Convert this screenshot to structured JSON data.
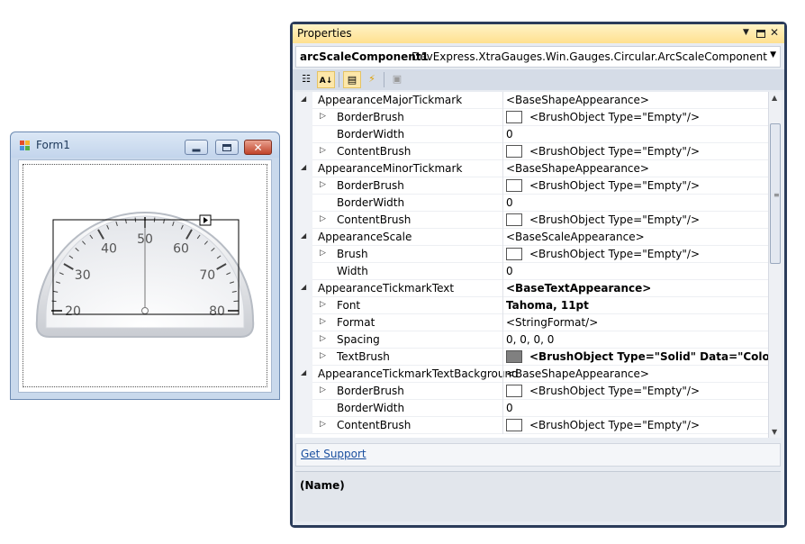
{
  "form": {
    "title": "Form1",
    "icon": "form-icon",
    "caption_buttons": [
      "minimize-icon",
      "maximize-icon",
      "close-icon"
    ]
  },
  "gauge": {
    "scale_min": 20,
    "scale_max": 80,
    "major_step": 10,
    "minor_step": 2,
    "needle_value": 50,
    "tick_labels": [
      "20",
      "30",
      "40",
      "50",
      "60",
      "70",
      "80"
    ],
    "smart_tag_icon": "smart-tag-arrow-icon"
  },
  "properties": {
    "window_title": "Properties",
    "titlebar_icons": [
      "dropdown-arrow-icon",
      "maximize-icon",
      "close-icon"
    ],
    "object_name": "arcScaleComponent1",
    "object_type": "DevExpress.XtraGauges.Win.Gauges.Circular.ArcScaleComponent",
    "toolbar": [
      "categorized-icon",
      "alphabetical-icon",
      "properties-icon",
      "events-icon",
      "property-pages-icon"
    ],
    "rows": [
      {
        "level": 0,
        "expander": "expanded",
        "name": "AppearanceMajorTickmark",
        "value": "<BaseShapeAppearance>",
        "swatch": "",
        "bold": false
      },
      {
        "level": 1,
        "expander": "collapsed",
        "name": "BorderBrush",
        "value": "<BrushObject Type=\"Empty\"/>",
        "swatch": "white",
        "bold": false
      },
      {
        "level": 1,
        "expander": "",
        "name": "BorderWidth",
        "value": "0",
        "swatch": "",
        "bold": false
      },
      {
        "level": 1,
        "expander": "collapsed",
        "name": "ContentBrush",
        "value": "<BrushObject Type=\"Empty\"/>",
        "swatch": "white",
        "bold": false
      },
      {
        "level": 0,
        "expander": "expanded",
        "name": "AppearanceMinorTickmark",
        "value": "<BaseShapeAppearance>",
        "swatch": "",
        "bold": false
      },
      {
        "level": 1,
        "expander": "collapsed",
        "name": "BorderBrush",
        "value": "<BrushObject Type=\"Empty\"/>",
        "swatch": "white",
        "bold": false
      },
      {
        "level": 1,
        "expander": "",
        "name": "BorderWidth",
        "value": "0",
        "swatch": "",
        "bold": false
      },
      {
        "level": 1,
        "expander": "collapsed",
        "name": "ContentBrush",
        "value": "<BrushObject Type=\"Empty\"/>",
        "swatch": "white",
        "bold": false
      },
      {
        "level": 0,
        "expander": "expanded",
        "name": "AppearanceScale",
        "value": "<BaseScaleAppearance>",
        "swatch": "",
        "bold": false
      },
      {
        "level": 1,
        "expander": "collapsed",
        "name": "Brush",
        "value": "<BrushObject Type=\"Empty\"/>",
        "swatch": "white",
        "bold": false
      },
      {
        "level": 1,
        "expander": "",
        "name": "Width",
        "value": "0",
        "swatch": "",
        "bold": false
      },
      {
        "level": 0,
        "expander": "expanded",
        "name": "AppearanceTickmarkText",
        "value": "<BaseTextAppearance>",
        "swatch": "",
        "bold": true
      },
      {
        "level": 1,
        "expander": "collapsed",
        "name": "Font",
        "value": "Tahoma, 11pt",
        "swatch": "",
        "bold": true
      },
      {
        "level": 1,
        "expander": "collapsed",
        "name": "Format",
        "value": "<StringFormat/>",
        "swatch": "",
        "bold": false
      },
      {
        "level": 1,
        "expander": "collapsed",
        "name": "Spacing",
        "value": "0, 0, 0, 0",
        "swatch": "",
        "bold": false
      },
      {
        "level": 1,
        "expander": "collapsed",
        "name": "TextBrush",
        "value": "<BrushObject Type=\"Solid\" Data=\"Color:Black\"",
        "swatch": "gray",
        "bold": true
      },
      {
        "level": 0,
        "expander": "expanded",
        "name": "AppearanceTickmarkTextBackground",
        "value": "<BaseShapeAppearance>",
        "swatch": "",
        "bold": false
      },
      {
        "level": 1,
        "expander": "collapsed",
        "name": "BorderBrush",
        "value": "<BrushObject Type=\"Empty\"/>",
        "swatch": "white",
        "bold": false
      },
      {
        "level": 1,
        "expander": "",
        "name": "BorderWidth",
        "value": "0",
        "swatch": "",
        "bold": false
      },
      {
        "level": 1,
        "expander": "collapsed",
        "name": "ContentBrush",
        "value": "<BrushObject Type=\"Empty\"/>",
        "swatch": "white",
        "bold": false
      }
    ],
    "commands_link": "Get Support",
    "description_name": "(Name)"
  },
  "colors": {
    "props_titlebar": "#ffe08f",
    "props_frame": "#2b3c5a",
    "link": "#1a4f9f"
  }
}
